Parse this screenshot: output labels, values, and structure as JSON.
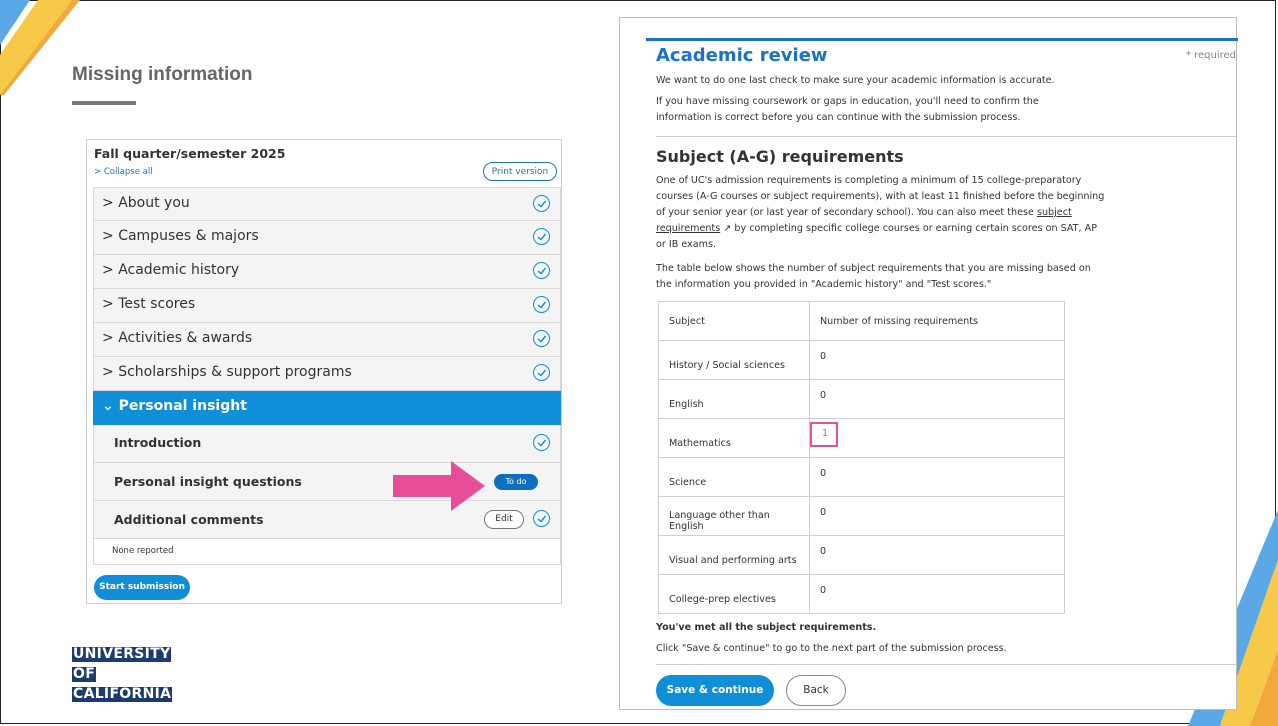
{
  "slide": {
    "title": "Missing information",
    "colors": {
      "accent_yellow": "#f7c948",
      "accent_blue": "#5aa9e6",
      "title_gray": "#666666",
      "arrow_pink": "#e84d9a"
    }
  },
  "left": {
    "term_title": "Fall quarter/semester 2025",
    "collapse_label": "Collapse all",
    "print_label": "Print version",
    "sections": [
      {
        "label": "About you",
        "status": "complete"
      },
      {
        "label": "Campuses & majors",
        "status": "complete"
      },
      {
        "label": "Academic history",
        "status": "complete"
      },
      {
        "label": "Test scores",
        "status": "complete"
      },
      {
        "label": "Activities & awards",
        "status": "complete"
      },
      {
        "label": "Scholarships & support programs",
        "status": "complete"
      }
    ],
    "active_section": "Personal insight",
    "subsections": [
      {
        "label": "Introduction",
        "status": "complete"
      },
      {
        "label": "Personal insight questions",
        "status": "To do"
      },
      {
        "label": "Additional comments",
        "status": "Edit"
      }
    ],
    "none_reported": "None reported",
    "start_label": "Start submission"
  },
  "logo": {
    "lines": [
      "UNIVERSITY",
      "OF",
      "CALIFORNIA"
    ]
  },
  "right": {
    "heading": "Academic review",
    "required": "* required",
    "intro1": "We want to do one last check to make sure your academic information is accurate.",
    "intro2": "If you have missing coursework or gaps in education, you'll need to confirm the information is correct before you can continue with the submission process.",
    "subheading": "Subject (A-G) requirements",
    "para1_a": "One of UC's admission requirements is completing a minimum of 15 college-preparatory courses (A-G courses or subject requirements), with at least 11 finished before the beginning of your senior year (or last year of secondary school). You can also meet these",
    "para1_link": "subject requirements",
    "para1_b": "by completing specific college courses or earning certain scores on SAT, AP or IB exams.",
    "para2": "The table below shows the number of subject requirements that you are missing based on the information you provided in \"Academic history\" and \"Test scores.\"",
    "table_headers": [
      "Subject",
      "Number of missing requirements"
    ],
    "table_rows": [
      [
        "History / Social sciences",
        "0"
      ],
      [
        "English",
        "0"
      ],
      [
        "Mathematics",
        "1"
      ],
      [
        "Science",
        "0"
      ],
      [
        "Language other than English",
        "0"
      ],
      [
        "Visual and performing arts",
        "0"
      ],
      [
        "College-prep electives",
        "0"
      ]
    ],
    "met_text": "You've met all the subject requirements.",
    "next_text": "Click \"Save & continue\" to go to the next part of the submission process.",
    "save_label": "Save & continue",
    "back_label": "Back"
  }
}
